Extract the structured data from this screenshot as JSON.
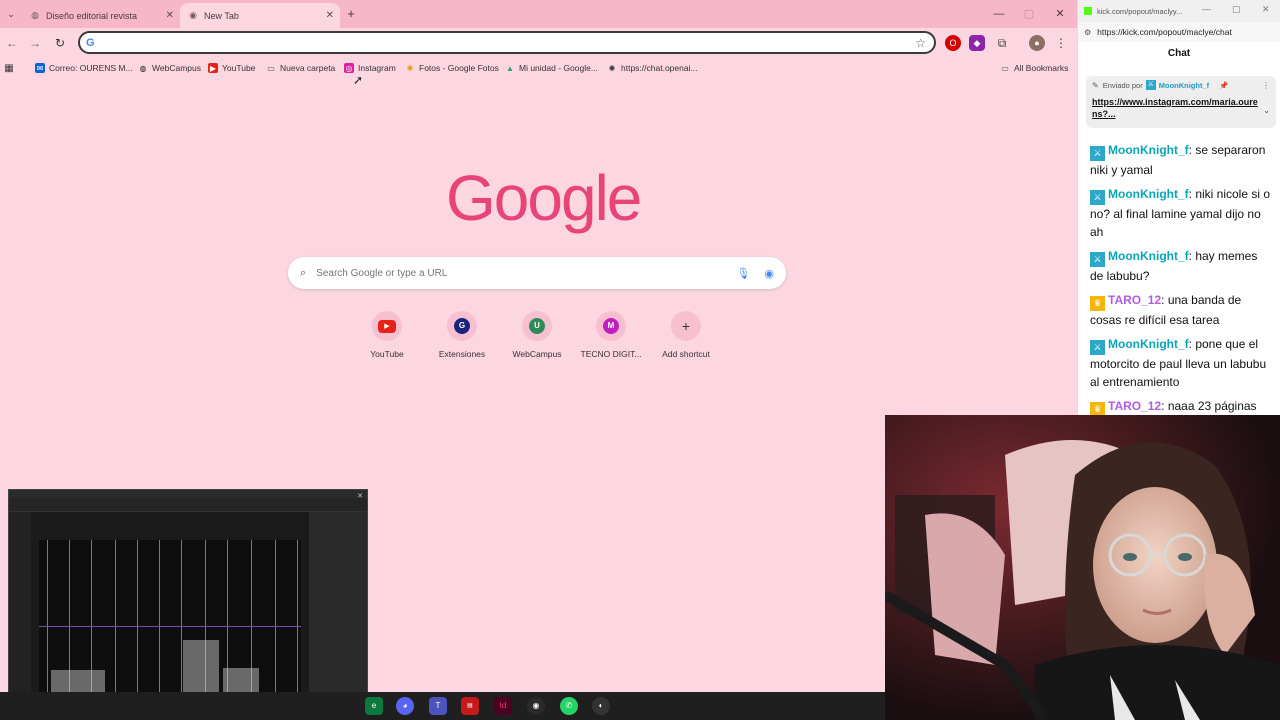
{
  "browser": {
    "tabs": [
      {
        "title": "Diseño editorial revista"
      },
      {
        "title": "New Tab"
      }
    ],
    "omnibox_value": "",
    "bookmarks": [
      {
        "label": "Correo: OURENS M..."
      },
      {
        "label": "WebCampus"
      },
      {
        "label": "YouTube"
      },
      {
        "label": "Nueva carpeta"
      },
      {
        "label": "Instagram"
      },
      {
        "label": "Fotos - Google Fotos"
      },
      {
        "label": "Mi unidad - Google..."
      },
      {
        "label": "https://chat.openai..."
      }
    ],
    "all_bookmarks": "All Bookmarks"
  },
  "google": {
    "logo": "Google",
    "search_placeholder": "Search Google or type a URL",
    "shortcuts": [
      {
        "label": "YouTube",
        "letter": "▶",
        "color": "#e62117"
      },
      {
        "label": "Extensiones",
        "letter": "G",
        "color": "#1a237e"
      },
      {
        "label": "WebCampus",
        "letter": "U",
        "color": "#2e8b57"
      },
      {
        "label": "TECNO DIGIT...",
        "letter": "M",
        "color": "#c21fc2"
      },
      {
        "label": "Add shortcut",
        "letter": "+",
        "color": ""
      }
    ]
  },
  "chat": {
    "window_title": "kick.com/popout/maclyy...",
    "url": "https://kick.com/popout/maclye/chat",
    "header": "Chat",
    "pinned": {
      "sent_by": "Enviado por",
      "user": "MoonKnight_f",
      "link": "https://www.instagram.com/maria.ourens?..."
    },
    "messages": [
      {
        "user": "MoonKnight_f",
        "badge": "sword",
        "text": "se separaron niki y yamal"
      },
      {
        "user": "MoonKnight_f",
        "badge": "sword",
        "text": "niki nicole si o no? al final lamine yamal dijo no ah"
      },
      {
        "user": "MoonKnight_f",
        "badge": "sword",
        "text": "hay memes de labubu?"
      },
      {
        "user": "TARO_12",
        "badge": "crown",
        "text": "una banda de cosas re difícil esa tarea"
      },
      {
        "user": "MoonKnight_f",
        "badge": "sword",
        "text": "pone que el motorcito de paul lleva un labubu al entrenamiento"
      },
      {
        "user": "TARO_12",
        "badge": "crown",
        "text": "naaa 23 páginas"
      }
    ]
  },
  "colors": {
    "page_bg": "#fcd7e1",
    "tabstrip": "#f6b7c9",
    "google_logo": "#e8447a",
    "kick_green": "#53fc18"
  }
}
